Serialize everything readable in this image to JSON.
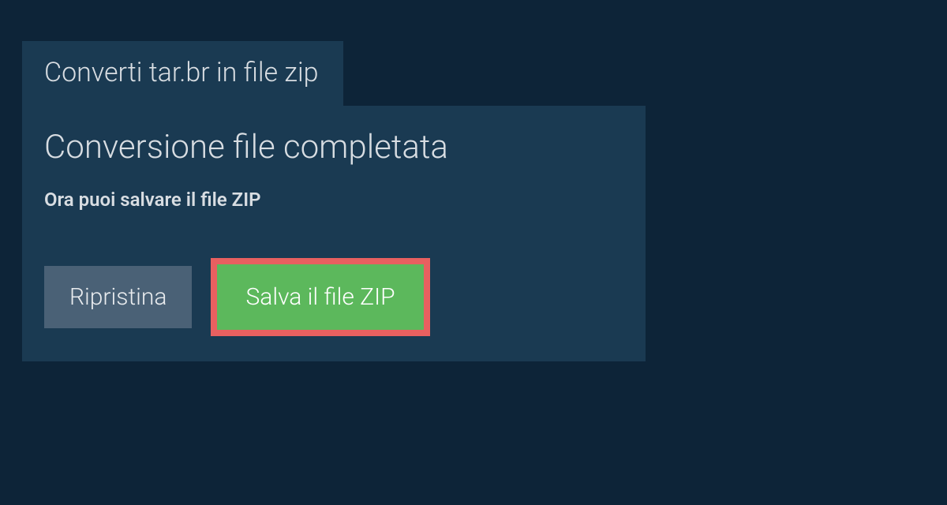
{
  "tab": {
    "label": "Converti tar.br in file zip"
  },
  "panel": {
    "title": "Conversione file completata",
    "subtitle": "Ora puoi salvare il file ZIP"
  },
  "buttons": {
    "reset_label": "Ripristina",
    "save_label": "Salva il file ZIP"
  }
}
